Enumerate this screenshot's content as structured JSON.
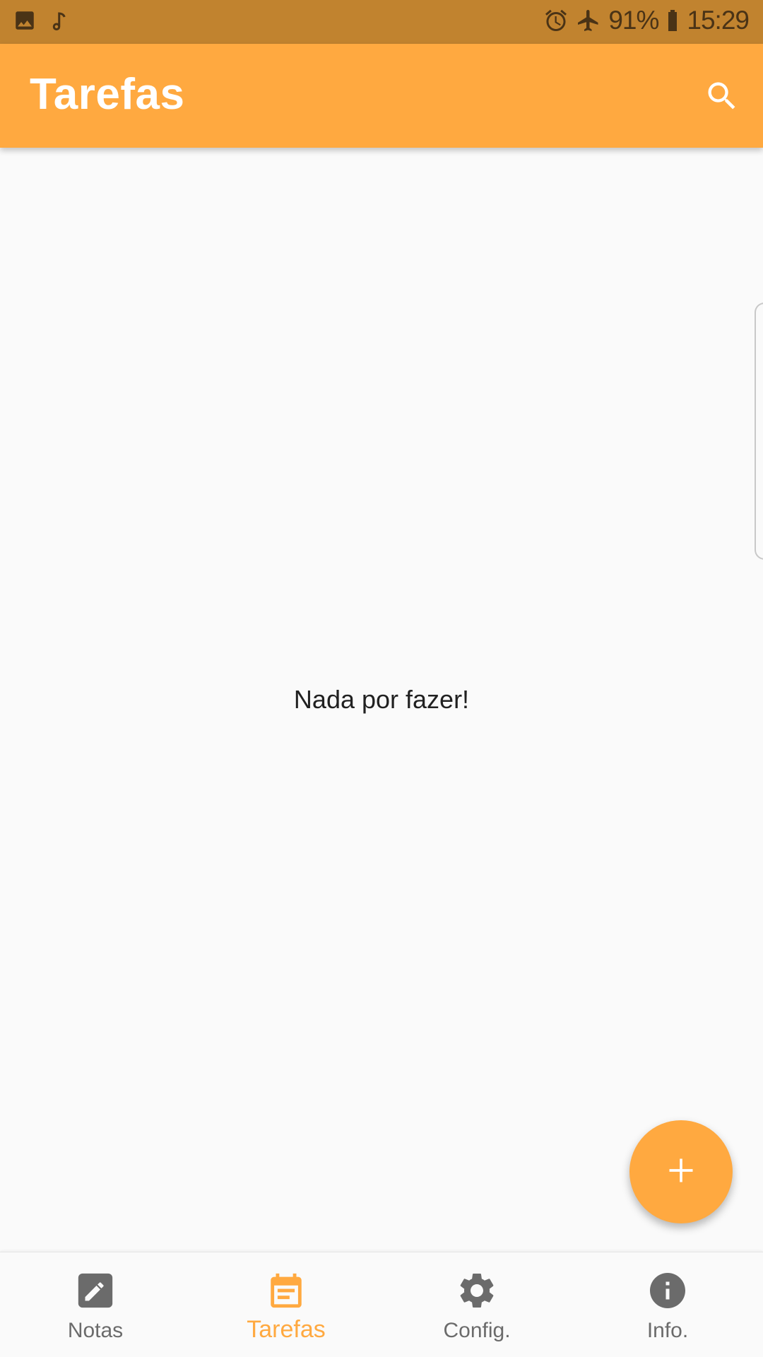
{
  "status_bar": {
    "battery_percent": "91%",
    "time": "15:29",
    "icons": [
      "image-icon",
      "music-note-icon",
      "alarm-icon",
      "airplane-mode-icon",
      "battery-icon"
    ]
  },
  "app_bar": {
    "title": "Tarefas",
    "search_icon": "search-icon"
  },
  "main": {
    "empty_message": "Nada por fazer!"
  },
  "fab": {
    "icon": "add-icon"
  },
  "bottom_nav": {
    "active_index": 1,
    "items": [
      {
        "label": "Notas",
        "icon": "edit-icon"
      },
      {
        "label": "Tarefas",
        "icon": "calendar-icon"
      },
      {
        "label": "Config.",
        "icon": "gear-icon"
      },
      {
        "label": "Info.",
        "icon": "info-icon"
      }
    ]
  },
  "colors": {
    "accent": "#ffa940",
    "status_bar": "#c1832f",
    "inactive_nav": "#6b6b6b"
  }
}
